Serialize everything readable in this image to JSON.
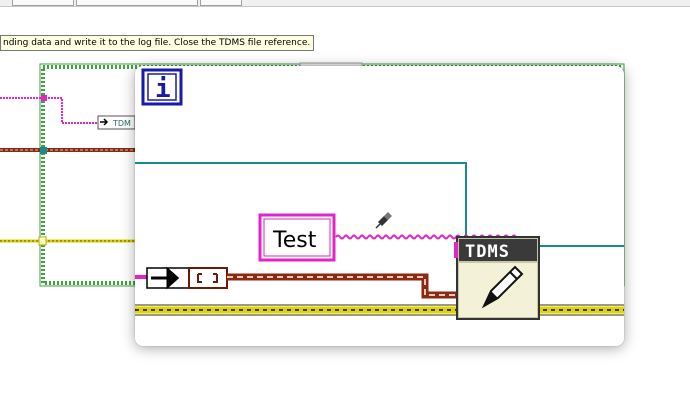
{
  "tooltip": {
    "text": "nding data and write it to the log file. Close the TDMS file reference."
  },
  "diagram": {
    "colors": {
      "string_wire": "#e026c8",
      "refnum_wire": "#8a2a12",
      "error_wire": "#e0d400",
      "numeric_wire": "#1a8a8a",
      "loop_border": "#3fa33f",
      "iteration_terminal": "#1a1aa8"
    },
    "small_tdms_label": "TDM",
    "iteration_icon": "i",
    "string_constant": "Test",
    "tdms_write": {
      "label": "TDMS",
      "icon": "pencil-icon"
    },
    "tunnel_icon": "arrow-right-icon",
    "refnum_icon": "bracket-icon",
    "cursor_icon": "pin-cursor-icon"
  }
}
